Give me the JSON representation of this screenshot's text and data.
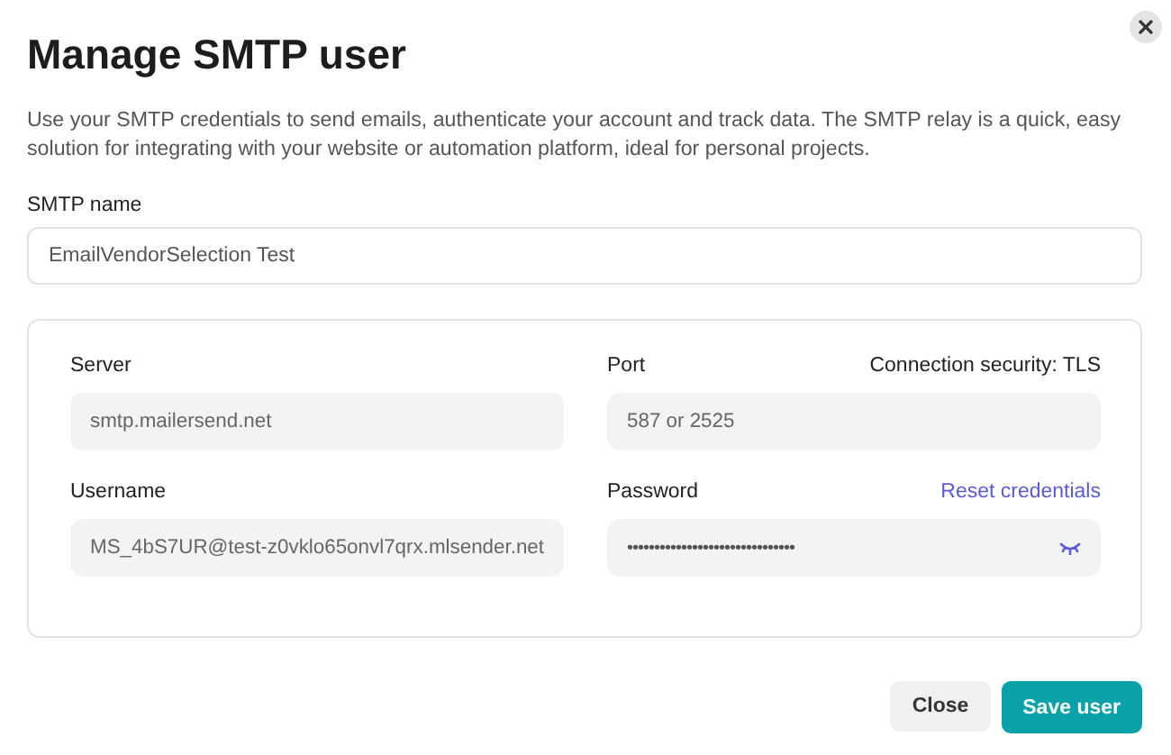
{
  "title": "Manage SMTP user",
  "description": "Use your SMTP credentials to send emails, authenticate your account and track data. The SMTP relay is a quick, easy solution for integrating with your website or automation platform, ideal for personal projects.",
  "smtp_name": {
    "label": "SMTP name",
    "value": "EmailVendorSelection Test"
  },
  "credentials": [
    {
      "label": "Server",
      "value": "smtp.mailersend.net",
      "kind": "text"
    },
    {
      "label": "Port",
      "value": "587 or 2525",
      "kind": "text",
      "aside": "Connection security: TLS"
    },
    {
      "label": "Username",
      "value": "MS_4bS7UR@test-z0vklo65onvl7qrx.mlsender.net",
      "kind": "text"
    },
    {
      "label": "Password",
      "value": "•••••••••••••••••••••••••••••••",
      "kind": "password",
      "link": "Reset credentials"
    }
  ],
  "buttons": [
    {
      "label": "Close",
      "kind": "secondary"
    },
    {
      "label": "Save user",
      "kind": "primary"
    }
  ]
}
